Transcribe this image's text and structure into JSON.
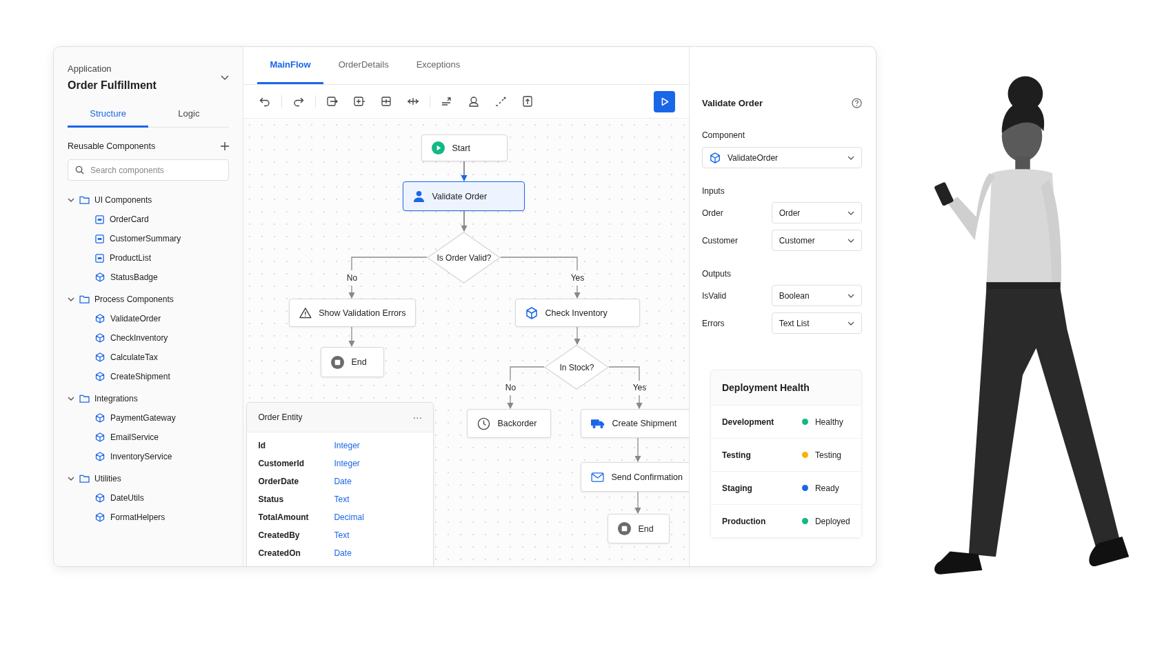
{
  "sidebar": {
    "app_label": "Application",
    "app_name": "Order Fulfillment",
    "tabs": [
      {
        "label": "Structure",
        "selected": true
      },
      {
        "label": "Logic",
        "selected": false
      }
    ],
    "section_title": "Reusable Components",
    "search": {
      "placeholder": "Search components"
    },
    "tree": [
      {
        "label": "UI Components",
        "expanded": true,
        "children": [
          {
            "label": "OrderCard",
            "kind": "ui"
          },
          {
            "label": "CustomerSummary",
            "kind": "ui"
          },
          {
            "label": "ProductList",
            "kind": "ui"
          },
          {
            "label": "StatusBadge",
            "kind": "component"
          }
        ]
      },
      {
        "label": "Process Components",
        "expanded": true,
        "children": [
          {
            "label": "ValidateOrder",
            "kind": "component"
          },
          {
            "label": "CheckInventory",
            "kind": "component"
          },
          {
            "label": "CalculateTax",
            "kind": "component"
          },
          {
            "label": "CreateShipment",
            "kind": "component"
          }
        ]
      },
      {
        "label": "Integrations",
        "expanded": true,
        "children": [
          {
            "label": "PaymentGateway",
            "kind": "component"
          },
          {
            "label": "EmailService",
            "kind": "component"
          },
          {
            "label": "InventoryService",
            "kind": "component"
          }
        ]
      },
      {
        "label": "Utilities",
        "expanded": true,
        "children": [
          {
            "label": "DateUtils",
            "kind": "component"
          },
          {
            "label": "FormatHelpers",
            "kind": "component"
          }
        ]
      }
    ]
  },
  "tabs": [
    {
      "label": "MainFlow",
      "selected": true
    },
    {
      "label": "OrderDetails",
      "selected": false
    },
    {
      "label": "Exceptions",
      "selected": false
    }
  ],
  "flow": {
    "nodes": [
      {
        "label": "Start",
        "kind": "start",
        "selected": false
      },
      {
        "label": "Validate Order",
        "kind": "user",
        "selected": true
      },
      {
        "label": "Is Order Valid?",
        "kind": "decision",
        "selected": false
      },
      {
        "label": "Show Validation Errors",
        "kind": "warning",
        "selected": false
      },
      {
        "label": "Check Inventory",
        "kind": "component",
        "selected": false
      },
      {
        "label": "End",
        "kind": "end",
        "selected": false
      },
      {
        "label": "In Stock?",
        "kind": "decision",
        "selected": false
      },
      {
        "label": "Backorder",
        "kind": "clock",
        "selected": false
      },
      {
        "label": "Create Shipment",
        "kind": "truck",
        "selected": false
      },
      {
        "label": "Send Confirmation",
        "kind": "mail",
        "selected": false
      },
      {
        "label": "End",
        "kind": "end",
        "selected": false
      }
    ],
    "branch_labels": [
      "No",
      "Yes",
      "No",
      "Yes"
    ]
  },
  "entity": {
    "title": "Order Entity",
    "menu": "···",
    "fields": [
      {
        "name": "Id",
        "type": "Integer"
      },
      {
        "name": "CustomerId",
        "type": "Integer"
      },
      {
        "name": "OrderDate",
        "type": "Date"
      },
      {
        "name": "Status",
        "type": "Text"
      },
      {
        "name": "TotalAmount",
        "type": "Decimal"
      },
      {
        "name": "CreatedBy",
        "type": "Text"
      },
      {
        "name": "CreatedOn",
        "type": "Date"
      }
    ]
  },
  "properties": {
    "title": "Validate Order",
    "component_label": "Component",
    "component": "ValidateOrder",
    "inputs_label": "Inputs",
    "inputs": [
      {
        "name": "Order",
        "value": "Order"
      },
      {
        "name": "Customer",
        "value": "Customer"
      }
    ],
    "outputs_label": "Outputs",
    "outputs": [
      {
        "name": "IsValid",
        "value": "Boolean"
      },
      {
        "name": "Errors",
        "value": "Text List"
      }
    ]
  },
  "health": {
    "title": "Deployment Health",
    "rows": [
      {
        "env": "Development",
        "status": "Healthy",
        "color": "#12b886"
      },
      {
        "env": "Testing",
        "status": "Testing",
        "color": "#fab005"
      },
      {
        "env": "Staging",
        "status": "Ready",
        "color": "#1a66e8"
      },
      {
        "env": "Production",
        "status": "Deployed",
        "color": "#12b886"
      }
    ]
  }
}
